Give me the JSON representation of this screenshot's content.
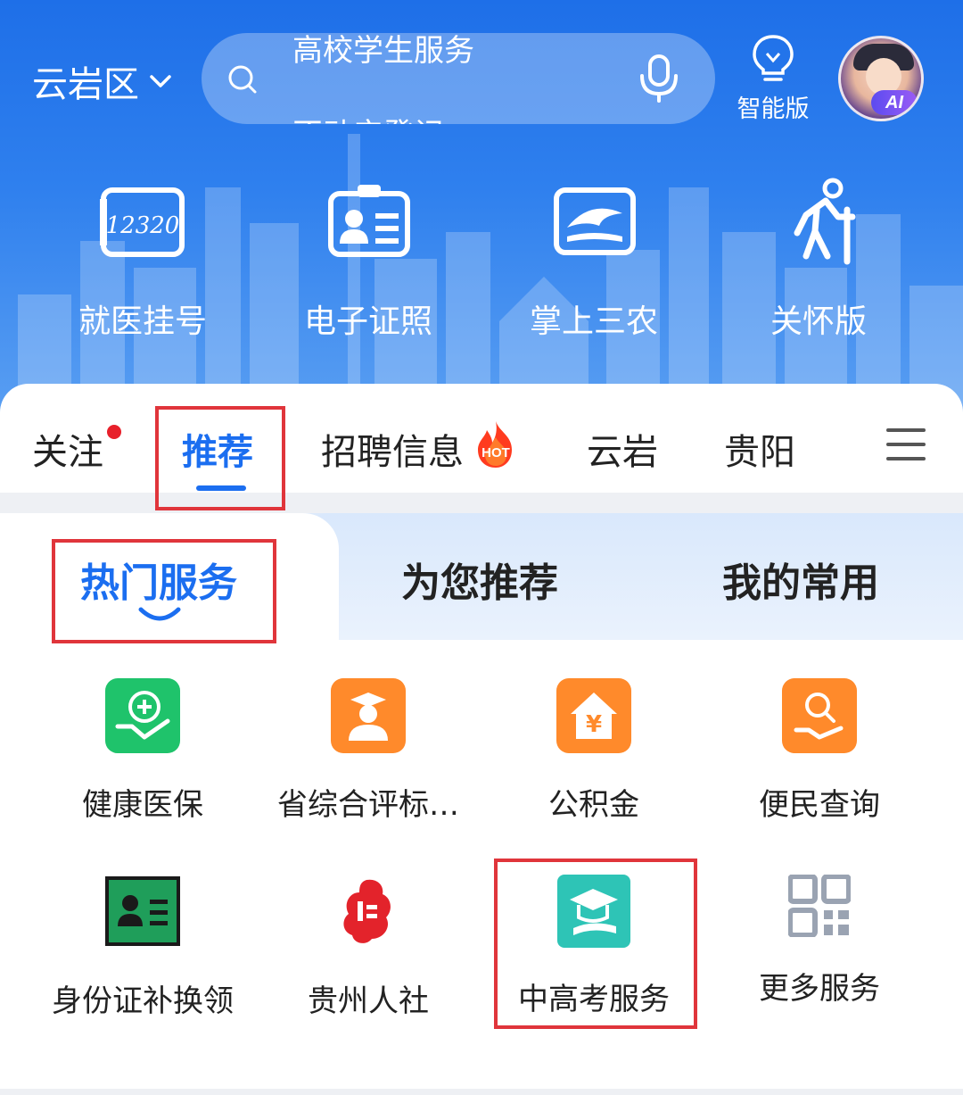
{
  "header": {
    "location": "云岩区",
    "search": {
      "placeholder_line1": "高校学生服务",
      "placeholder_line2": "不动产登记"
    },
    "smart_label": "智能版",
    "avatar_badge": "AI"
  },
  "quick_actions": [
    {
      "label": "就医挂号",
      "icon": "hospital-12320-icon"
    },
    {
      "label": "电子证照",
      "icon": "id-card-icon"
    },
    {
      "label": "掌上三农",
      "icon": "farming-icon"
    },
    {
      "label": "关怀版",
      "icon": "elderly-care-icon"
    }
  ],
  "tabs": [
    {
      "label": "关注",
      "has_dot": true
    },
    {
      "label": "推荐",
      "active": true
    },
    {
      "label": "招聘信息",
      "badge": "HOT"
    },
    {
      "label": "云岩"
    },
    {
      "label": "贵阳"
    }
  ],
  "subtabs": [
    {
      "label": "热门服务",
      "active": true
    },
    {
      "label": "为您推荐"
    },
    {
      "label": "我的常用"
    }
  ],
  "services": [
    {
      "label": "健康医保",
      "icon": "health-insurance-icon",
      "color": "#1fc36b"
    },
    {
      "label": "省综合评标…",
      "icon": "graduate-icon",
      "color": "#ff8a2b"
    },
    {
      "label": "公积金",
      "icon": "housing-fund-icon",
      "color": "#ff8a2b"
    },
    {
      "label": "便民查询",
      "icon": "search-hand-icon",
      "color": "#ff8a2b"
    },
    {
      "label": "身份证补换领",
      "icon": "id-card-green-icon",
      "color": "#1f9e5a"
    },
    {
      "label": "贵州人社",
      "icon": "guizhou-hrss-seal-icon",
      "color": "#e3232b"
    },
    {
      "label": "中高考服务",
      "icon": "exam-cap-icon",
      "color": "#2ec4b6"
    },
    {
      "label": "更多服务",
      "icon": "more-qr-icon",
      "color": "#9aa3b2"
    }
  ],
  "colors": {
    "accent": "#1b6ef0",
    "header_blue": "#2f80ee",
    "highlight_red": "#e0353b"
  }
}
